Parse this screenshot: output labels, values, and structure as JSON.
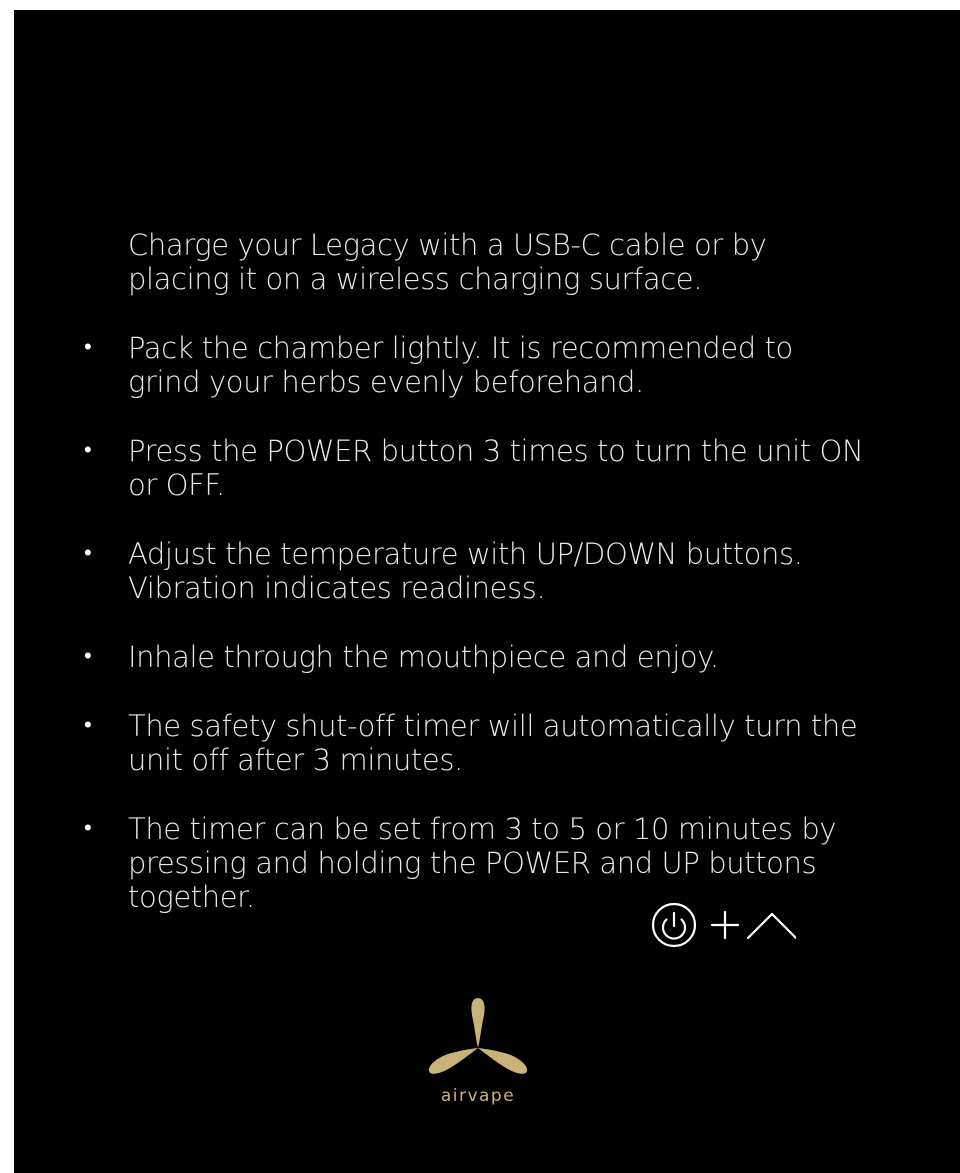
{
  "instructions": [
    {
      "text": "Charge your Legacy with a USB-C cable or by placing it on a wireless charging surface.",
      "bullet": false
    },
    {
      "text": "Pack the chamber lightly. It is recommended to grind your herbs evenly beforehand.",
      "bullet": true
    },
    {
      "text": "Press the POWER button 3 times to turn the unit ON or OFF.",
      "bullet": true
    },
    {
      "text": "Adjust the temperature with UP/DOWN buttons. Vibration indicates readiness.",
      "bullet": true
    },
    {
      "text": "Inhale through the mouthpiece and enjoy.",
      "bullet": true
    },
    {
      "text": "The safety shut-off timer will automatically turn the unit off after 3 minutes.",
      "bullet": true
    },
    {
      "text": "The timer can be set from 3  to 5 or 10 minutes by pressing and holding the POWER and UP buttons together.",
      "bullet": true
    }
  ],
  "bullet_glyph": "•",
  "combo": {
    "icons": [
      "power-icon",
      "plus-icon",
      "chevron-up-icon"
    ],
    "color": "#ffffff"
  },
  "brand": {
    "name": "airvape",
    "color": "#c9b17a"
  },
  "colors": {
    "background": "#000000",
    "text": "#e8e8e8"
  }
}
